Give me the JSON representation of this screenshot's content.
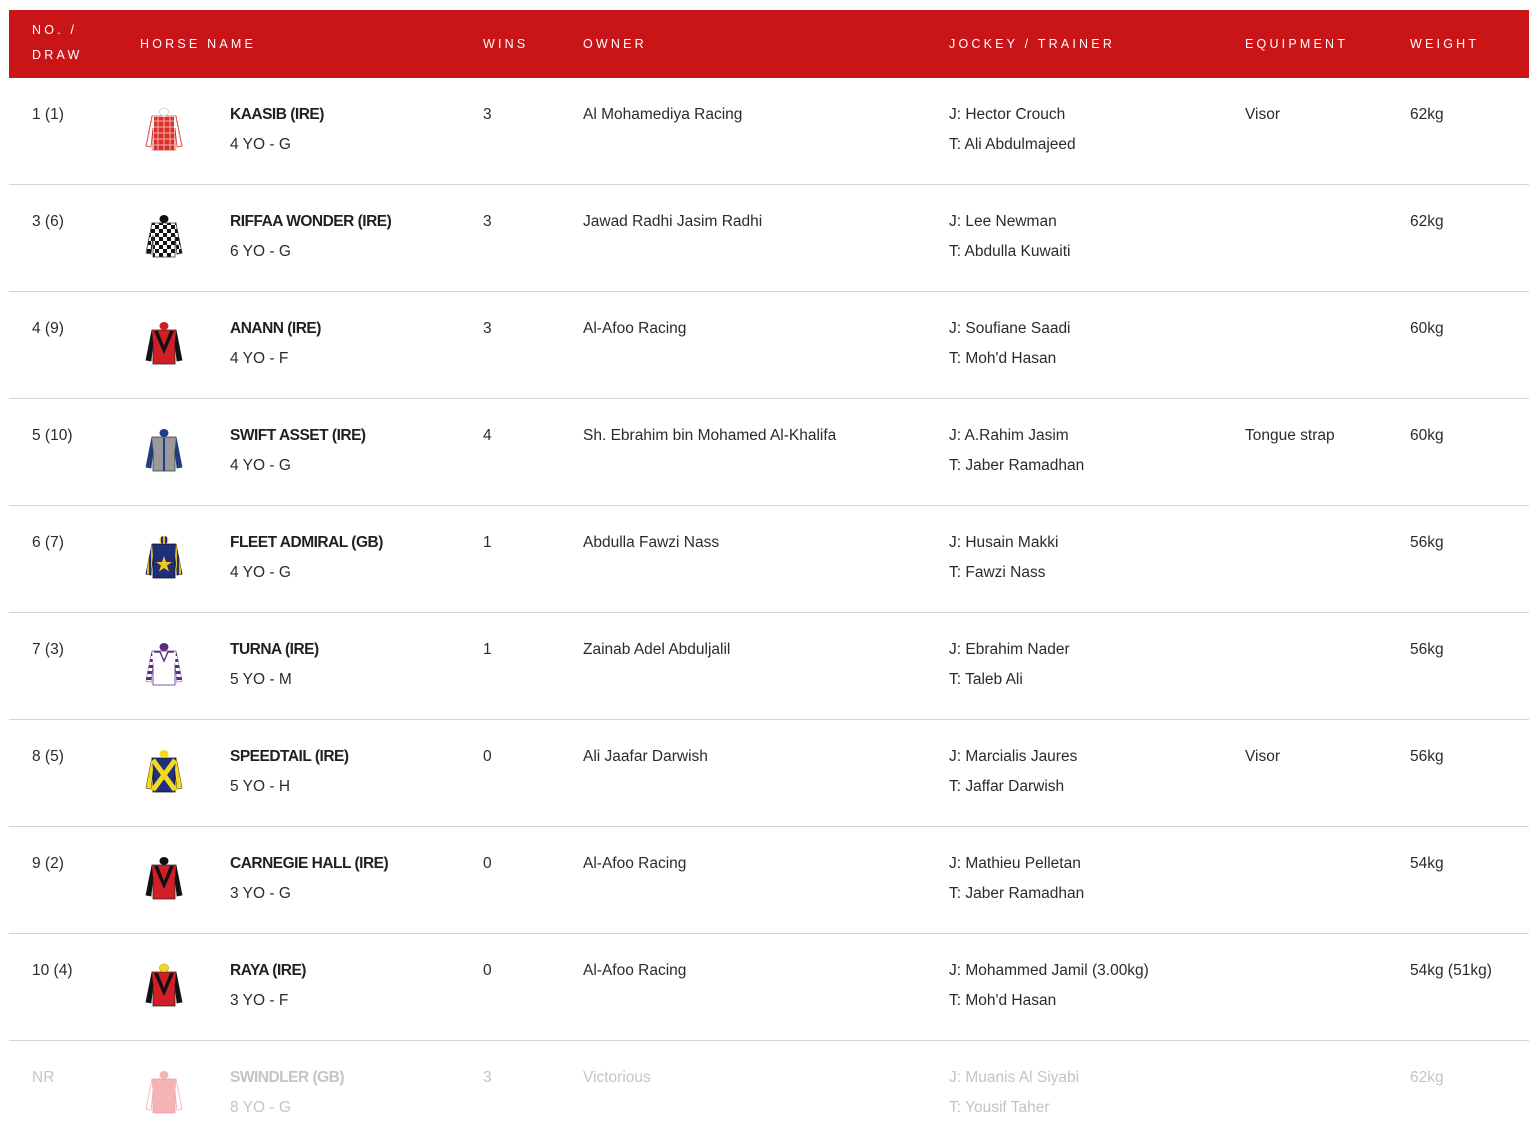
{
  "header": {
    "no_line1": "NO. /",
    "no_line2": "DRAW",
    "horse_name": "HORSE NAME",
    "wins": "WINS",
    "owner": "OWNER",
    "jockey_trainer": "JOCKEY / TRAINER",
    "equipment": "EQUIPMENT",
    "weight": "WEIGHT"
  },
  "colors": {
    "header_bg": "#c91418",
    "row_divider": "#d4d4d4",
    "nr_text": "#c4c4c4"
  },
  "runners": [
    {
      "no": "1 (1)",
      "name": "KAASIB (IRE)",
      "age": "4 YO - G",
      "wins": "3",
      "owner": "Al Mohamediya Racing",
      "jockey": "J: Hector Crouch",
      "trainer": "T: Ali Abdulmajeed",
      "equipment": "Visor",
      "weight": "62kg",
      "silk": "red-check-white-sleeves-icon"
    },
    {
      "no": "3 (6)",
      "name": "RIFFAA WONDER (IRE)",
      "age": "6 YO - G",
      "wins": "3",
      "owner": "Jawad Radhi Jasim Radhi",
      "jockey": "J: Lee Newman",
      "trainer": "T: Abdulla Kuwaiti",
      "equipment": "",
      "weight": "62kg",
      "silk": "black-white-check-icon"
    },
    {
      "no": "4 (9)",
      "name": "ANANN (IRE)",
      "age": "4 YO - F",
      "wins": "3",
      "owner": "Al-Afoo Racing",
      "jockey": "J: Soufiane Saadi",
      "trainer": "T: Moh'd Hasan",
      "equipment": "",
      "weight": "60kg",
      "silk": "red-black-chevron-icon"
    },
    {
      "no": "5 (10)",
      "name": "SWIFT ASSET (IRE)",
      "age": "4 YO - G",
      "wins": "4",
      "owner": "Sh. Ebrahim bin Mohamed Al-Khalifa",
      "jockey": "J: A.Rahim Jasim",
      "trainer": "T: Jaber Ramadhan",
      "equipment": "Tongue strap",
      "weight": "60kg",
      "silk": "grey-blue-sleeves-icon"
    },
    {
      "no": "6 (7)",
      "name": "FLEET ADMIRAL (GB)",
      "age": "4 YO - G",
      "wins": "1",
      "owner": "Abdulla Fawzi Nass",
      "jockey": "J: Husain Makki",
      "trainer": "T: Fawzi Nass",
      "equipment": "",
      "weight": "56kg",
      "silk": "navy-gold-star-icon"
    },
    {
      "no": "7 (3)",
      "name": "TURNA (IRE)",
      "age": "5 YO - M",
      "wins": "1",
      "owner": "Zainab Adel Abduljalil",
      "jockey": "J: Ebrahim Nader",
      "trainer": "T: Taleb Ali",
      "equipment": "",
      "weight": "56kg",
      "silk": "white-purple-hoops-icon"
    },
    {
      "no": "8 (5)",
      "name": "SPEEDTAIL (IRE)",
      "age": "5 YO - H",
      "wins": "0",
      "owner": "Ali Jaafar Darwish",
      "jockey": "J: Marcialis Jaures",
      "trainer": "T: Jaffar Darwish",
      "equipment": "Visor",
      "weight": "56kg",
      "silk": "navy-yellow-cross-icon"
    },
    {
      "no": "9 (2)",
      "name": "CARNEGIE HALL (IRE)",
      "age": "3 YO - G",
      "wins": "0",
      "owner": "Al-Afoo Racing",
      "jockey": "J: Mathieu Pelletan",
      "trainer": "T: Jaber Ramadhan",
      "equipment": "",
      "weight": "54kg",
      "silk": "red-black-chevron-icon"
    },
    {
      "no": "10 (4)",
      "name": "RAYA (IRE)",
      "age": "3 YO - F",
      "wins": "0",
      "owner": "Al-Afoo Racing",
      "jockey": "J: Mohammed Jamil (3.00kg)",
      "trainer": "T: Moh'd Hasan",
      "equipment": "",
      "weight": "54kg (51kg)",
      "silk": "red-black-chevron-yellow-cap-icon"
    },
    {
      "no": "NR",
      "name": "SWINDLER (GB)",
      "age": "8 YO - G",
      "wins": "3",
      "owner": "Victorious",
      "jockey": "J: Muanis Al Siyabi",
      "trainer": "T: Yousif Taher",
      "equipment": "",
      "weight": "62kg",
      "silk": "pink-white-icon"
    }
  ]
}
